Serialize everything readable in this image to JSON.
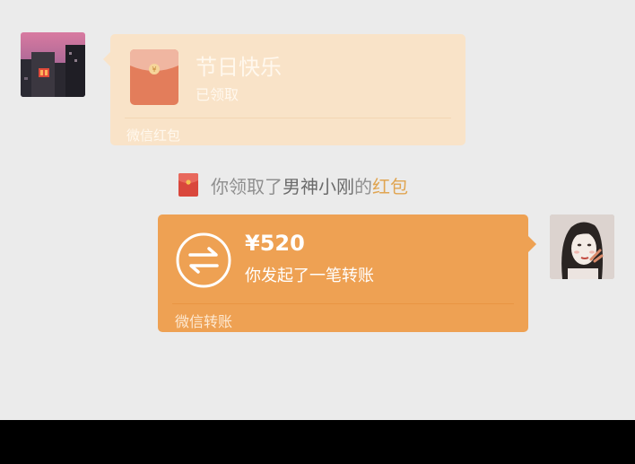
{
  "red_packet": {
    "title": "节日快乐",
    "status": "已领取",
    "footer": "微信红包"
  },
  "notice": {
    "prefix": "你领取了",
    "sender": "男神小刚",
    "middle": "的",
    "link": "红包"
  },
  "transfer": {
    "amount": "¥520",
    "description": "你发起了一笔转账",
    "footer": "微信转账"
  },
  "colors": {
    "background": "#ebebeb",
    "red_packet_bubble": "#f9e3c8",
    "transfer_bubble": "#eea153",
    "notice_link": "#e0a552",
    "envelope_red": "#e37d5b",
    "bottom_bar": "#000000"
  },
  "icons": {
    "red_packet": "red-envelope-icon",
    "transfer": "transfer-arrows-icon",
    "notice": "small-red-envelope-icon"
  }
}
